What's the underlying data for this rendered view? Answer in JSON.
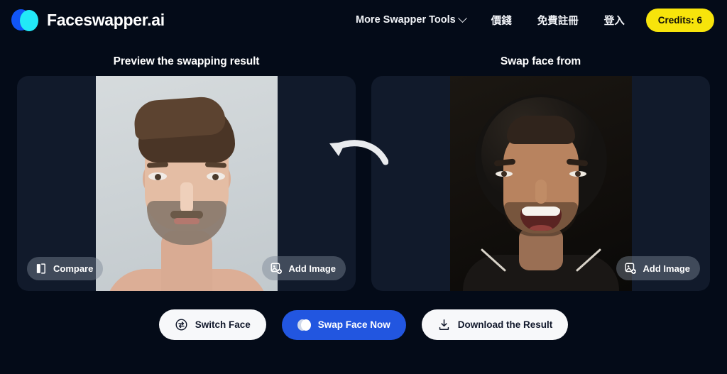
{
  "brand": {
    "name": "Faceswapper.ai",
    "logo_icon": "overlapping-circles-logo",
    "logo_color_back": "#1155f5",
    "logo_color_front": "#22e8f7"
  },
  "header": {
    "nav_items": [
      {
        "label": "More Swapper Tools",
        "has_dropdown": true,
        "icon": "chevron-down-icon"
      },
      {
        "label": "價錢",
        "has_dropdown": false
      },
      {
        "label": "免費註冊",
        "has_dropdown": false
      },
      {
        "label": "登入",
        "has_dropdown": false
      }
    ],
    "credits": {
      "label": "Credits: 6",
      "count": 6,
      "background": "#f7e40b",
      "text_color": "#0a0a0a"
    }
  },
  "panels": {
    "left": {
      "title": "Preview the swapping result",
      "compare_button": {
        "label": "Compare",
        "icon": "compare-split-icon"
      },
      "add_image_button": {
        "label": "Add Image",
        "icon": "image-plus-icon"
      },
      "image_alt": "Portrait of a man with brown swept-back hair and a short beard on a light grey studio background"
    },
    "right": {
      "title": "Swap face from",
      "add_image_button": {
        "label": "Add Image",
        "icon": "image-plus-icon"
      },
      "image_alt": "Portrait of a smiling young man wearing a dark wide-brim hat against a dark background"
    }
  },
  "arrow": {
    "icon": "curved-left-arrow-icon",
    "color": "#e9ebee"
  },
  "actions": [
    {
      "label": "Switch Face",
      "icon": "switch-arrows-circle-icon",
      "style": "light"
    },
    {
      "label": "Swap Face Now",
      "icon": "overlapping-circles-logo",
      "style": "primary",
      "background": "#2256e0"
    },
    {
      "label": "Download the Result",
      "icon": "download-icon",
      "style": "light"
    }
  ],
  "theme": {
    "page_background": "#040b18",
    "panel_background": "#111a2b",
    "text_primary": "#ffffff"
  }
}
